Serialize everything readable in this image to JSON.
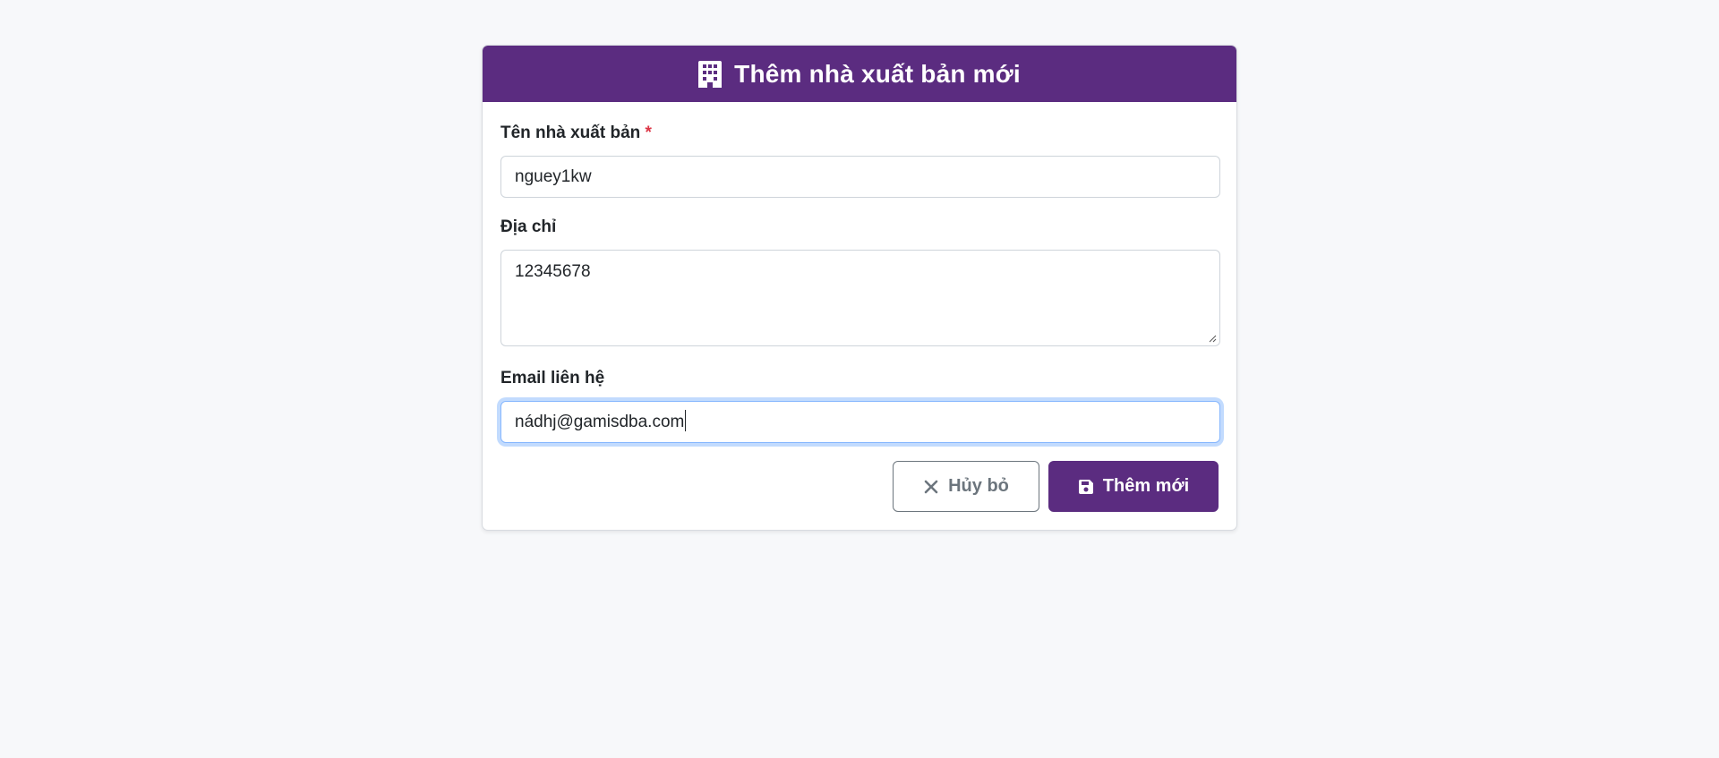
{
  "header": {
    "icon": "building-icon",
    "title": "Thêm nhà xuất bản mới"
  },
  "form": {
    "name": {
      "label": "Tên nhà xuất bản",
      "required_mark": "*",
      "value": "nguey1kw"
    },
    "address": {
      "label": "Địa chỉ",
      "value": "12345678"
    },
    "email": {
      "label": "Email liên hệ",
      "value": "nádhj@gamisdba.com"
    }
  },
  "actions": {
    "cancel_icon": "close-icon",
    "cancel_label": "Hủy bỏ",
    "submit_icon": "save-icon",
    "submit_label": "Thêm mới"
  },
  "colors": {
    "brand": "#5b2c80",
    "required": "#dc3545",
    "secondary": "#6c757d",
    "focus": "#86b7fe"
  }
}
